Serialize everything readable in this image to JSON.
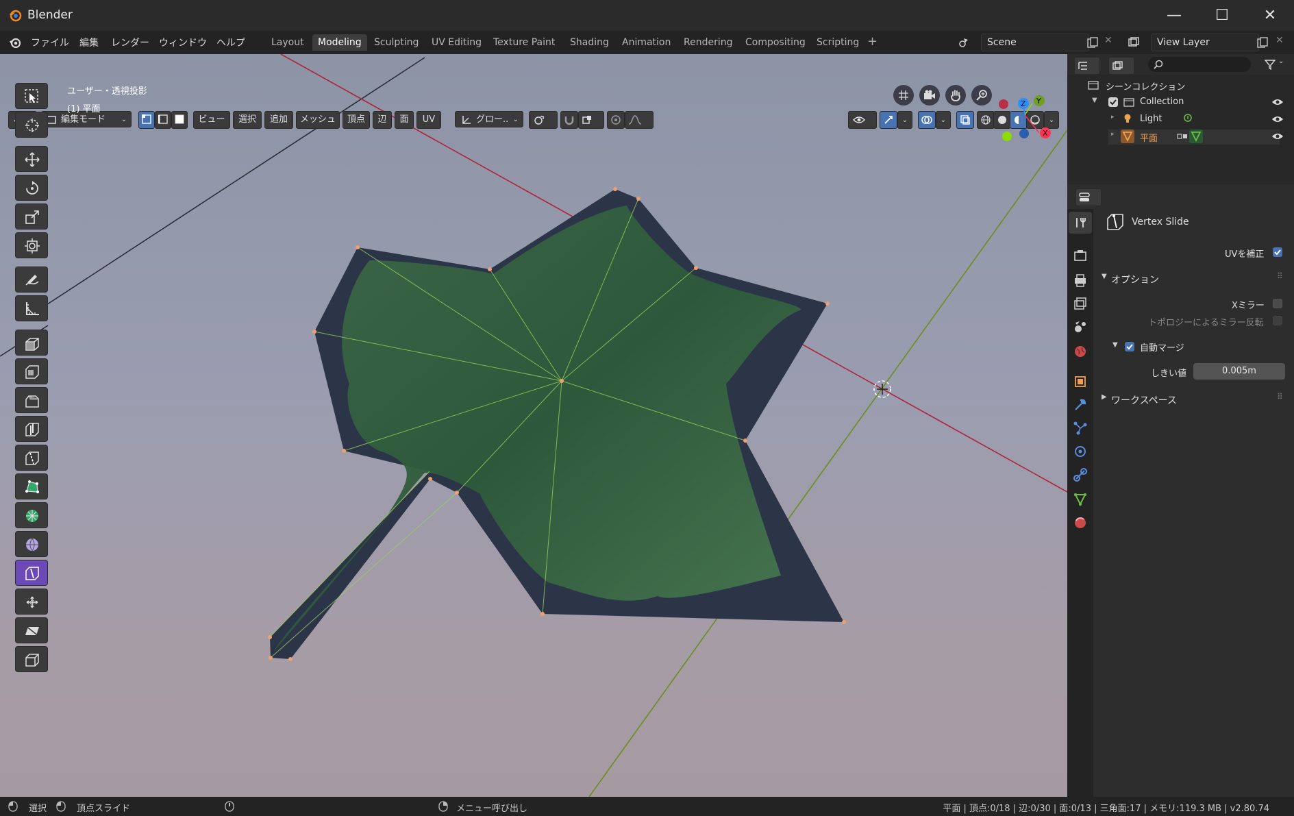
{
  "window": {
    "title": "Blender",
    "minimize": "—",
    "maximize": "☐",
    "close": "✕"
  },
  "menu": [
    "ファイル",
    "編集",
    "レンダー",
    "ウィンドウ",
    "ヘルプ"
  ],
  "workspaces": [
    "Layout",
    "Modeling",
    "Sculpting",
    "UV Editing",
    "Texture Paint",
    "Shading",
    "Animation",
    "Rendering",
    "Compositing",
    "Scripting"
  ],
  "active_workspace": "Modeling",
  "add_tab": "+",
  "scene": {
    "name": "Scene",
    "view_layer": "View Layer"
  },
  "viewport_header": {
    "mode": "編集モード",
    "menus": [
      "ビュー",
      "選択",
      "追加",
      "メッシュ",
      "頂点",
      "辺",
      "面",
      "UV"
    ],
    "transform_orientation": "グロー.."
  },
  "viewport_overlay": {
    "view_name": "ユーザー・透視投影",
    "object_name": "(1) 平面"
  },
  "gizmo": {
    "z": "Z",
    "y": "Y",
    "x": "X"
  },
  "outliner": {
    "root": "シーンコレクション",
    "items": [
      {
        "label": "Collection",
        "type": "collection"
      },
      {
        "label": "Light",
        "type": "light"
      },
      {
        "label": "平面",
        "type": "mesh"
      }
    ]
  },
  "properties": {
    "tool_name": "Vertex Slide",
    "uv_correct": "UVを補正",
    "options_header": "オプション",
    "x_mirror": "Xミラー",
    "topology_mirror": "トポロジーによるミラー反転",
    "auto_merge": "自動マージ",
    "threshold_label": "しきい値",
    "threshold_value": "0.005m",
    "workspace_header": "ワークスペース"
  },
  "statusbar": {
    "select": "選択",
    "vertex_slide": "頂点スライド",
    "menu_call": "メニュー呼び出し",
    "stats": "平面 | 頂点:0/18 | 辺:0/30 | 面:0/13 | 三角面:17 | メモリ:119.3 MB | v2.80.74"
  },
  "colors": {
    "accent": "#4772b3",
    "active_tool": "#6b4ab8",
    "axis_x": "#ff3352",
    "axis_y": "#8bdc00",
    "axis_z": "#2890ff"
  }
}
